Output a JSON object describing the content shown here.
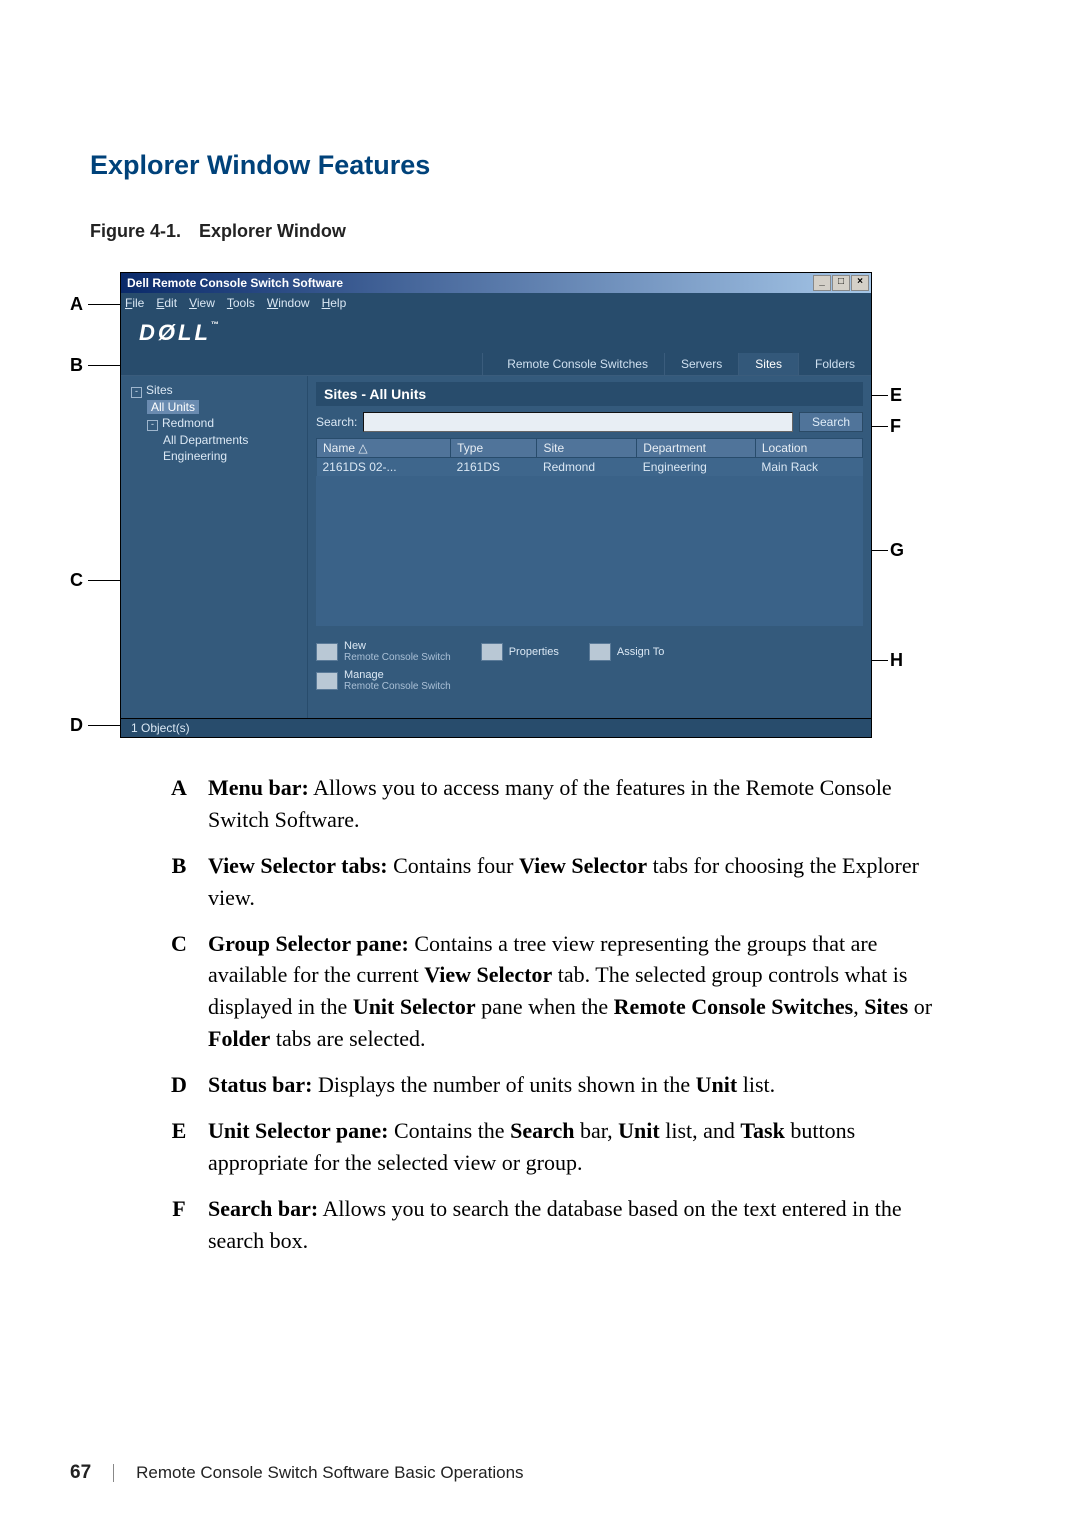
{
  "headings": {
    "section": "Explorer Window Features",
    "figure": "Figure 4-1. Explorer Window"
  },
  "window": {
    "title": "Dell Remote Console Switch Software",
    "menus": {
      "file": "File",
      "edit": "Edit",
      "view": "View",
      "tools": "Tools",
      "window": "Window",
      "help": "Help"
    },
    "logo_text": "DØLL",
    "tm": "™",
    "tabs": {
      "remote": "Remote Console Switches",
      "servers": "Servers",
      "sites": "Sites",
      "folders": "Folders"
    },
    "tree": {
      "root": "Sites",
      "all_units": "All Units",
      "redmond": "Redmond",
      "all_departments": "All Departments",
      "engineering": "Engineering"
    },
    "pane_title": "Sites - All Units",
    "search_label": "Search:",
    "search_button": "Search",
    "table": {
      "headers": {
        "name": "Name",
        "type": "Type",
        "site": "Site",
        "department": "Department",
        "location": "Location"
      },
      "row": {
        "name": "2161DS 02-...",
        "type": "2161DS",
        "site": "Redmond",
        "department": "Engineering",
        "location": "Main Rack"
      }
    },
    "tasks": {
      "new_top": "New",
      "new_sub": "Remote Console Switch",
      "properties": "Properties",
      "assign": "Assign To",
      "manage_top": "Manage",
      "manage_sub": "Remote Console Switch"
    },
    "status": "1 Object(s)"
  },
  "callouts": {
    "A": "A",
    "B": "B",
    "C": "C",
    "D": "D",
    "E": "E",
    "F": "F",
    "G": "G",
    "H": "H"
  },
  "legend": {
    "A": {
      "term": "Menu bar:",
      "text": " Allows you to access many of the features in the Remote Console Switch Software."
    },
    "B": {
      "term": "View Selector tabs:",
      "before": " Contains four ",
      "bold": "View Selector",
      "after": " tabs for choosing the Explorer view."
    },
    "C": {
      "term": "Group Selector pane:",
      "p1_before": " Contains a tree view representing the groups that are available for the current ",
      "p1_bold": "View Selector",
      "p1_after": " tab. The selected group controls what is displayed in the ",
      "p2_bold": "Unit Selector",
      "p2_after": " pane when the ",
      "p3_bold": "Remote Console Switches",
      "p3_after": ", ",
      "p4_bold": "Sites",
      "p4_after": " or ",
      "p5_bold": "Folder",
      "p5_after": " tabs are selected."
    },
    "D": {
      "term": "Status bar:",
      "before": " Displays the number of units shown in the ",
      "bold": "Unit",
      "after": " list."
    },
    "E": {
      "term": "Unit Selector pane:",
      "before": " Contains the ",
      "b1": "Search",
      "m1": " bar, ",
      "b2": "Unit",
      "m2": " list, and ",
      "b3": "Task",
      "after": " buttons appropriate for the selected view or group."
    },
    "F": {
      "term": "Search bar:",
      "text": " Allows you to search the database based on the text entered in the search box."
    }
  },
  "footer": {
    "page": "67",
    "chapter": "Remote Console Switch Software Basic Operations"
  }
}
